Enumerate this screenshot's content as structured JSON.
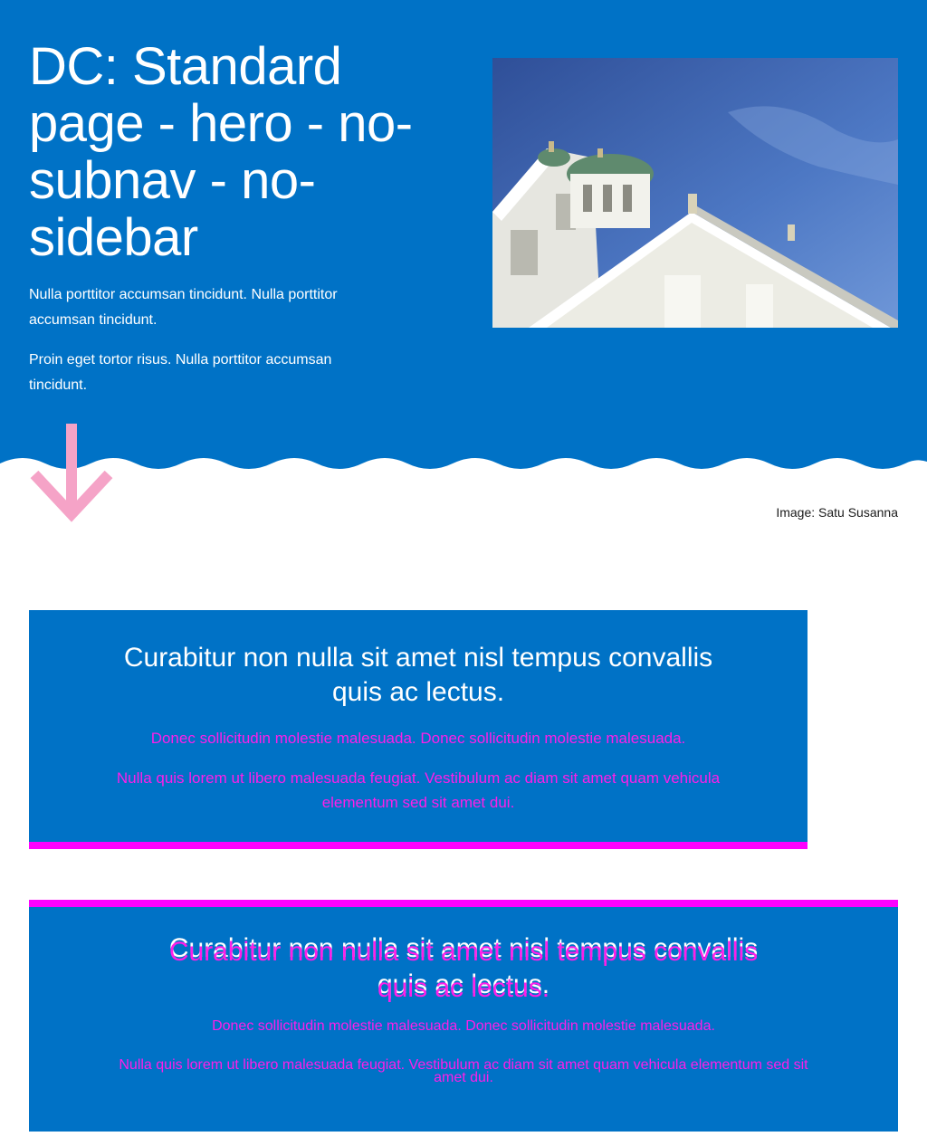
{
  "hero": {
    "title": "DC: Standard page - hero - no-subnav - no-sidebar",
    "paragraph1": "Nulla porttitor accumsan tincidunt. Nulla porttitor accumsan tincidunt.",
    "paragraph2": "Proin eget tortor risus. Nulla porttitor accumsan tincidunt.",
    "image_caption": "Image: Satu Susanna"
  },
  "banner1": {
    "title": "Curabitur non nulla sit amet nisl tempus convallis quis ac lectus.",
    "text1": "Donec sollicitudin molestie malesuada. Donec sollicitudin molestie malesuada.",
    "text2": "Nulla quis lorem ut libero malesuada feugiat. Vestibulum ac diam sit amet quam vehicula elementum sed sit amet dui."
  },
  "banner2": {
    "title": "Curabitur non nulla sit amet nisl tempus convallis quis ac lectus.",
    "text1": "Donec sollicitudin molestie malesuada. Donec sollicitudin molestie malesuada.",
    "text2": "Nulla quis lorem ut libero malesuada feugiat. Vestibulum ac diam sit amet quam vehicula elementum sed sit amet dui."
  },
  "colors": {
    "brand_blue": "#0072c6",
    "accent_pink": "#ff00ff",
    "arrow_pink": "#f5a3c7"
  }
}
